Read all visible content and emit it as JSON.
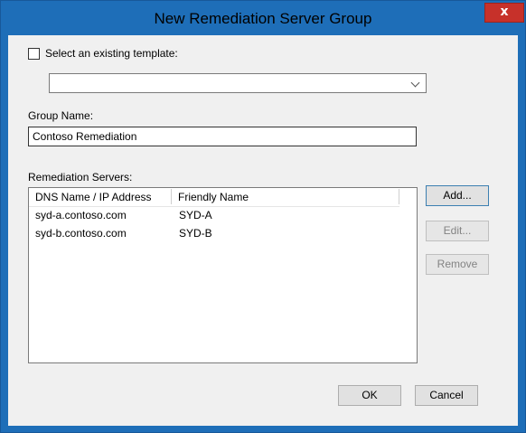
{
  "window": {
    "title": "New Remediation Server Group",
    "close_glyph": "x"
  },
  "template": {
    "checkbox_label": "Select an existing template:",
    "checked": false,
    "selected_value": ""
  },
  "group_name": {
    "label": "Group Name:",
    "value": "Contoso Remediation"
  },
  "servers": {
    "label": "Remediation Servers:",
    "columns": [
      "DNS Name / IP Address",
      "Friendly Name"
    ],
    "rows": [
      {
        "dns": "syd-a.contoso.com",
        "friendly": "SYD-A"
      },
      {
        "dns": "syd-b.contoso.com",
        "friendly": "SYD-B"
      }
    ]
  },
  "side_buttons": {
    "add": "Add...",
    "edit": "Edit...",
    "remove": "Remove"
  },
  "footer": {
    "ok": "OK",
    "cancel": "Cancel"
  },
  "colors": {
    "frame": "#1e6eb8",
    "client": "#f0f0f0",
    "close_button": "#c7312a"
  }
}
